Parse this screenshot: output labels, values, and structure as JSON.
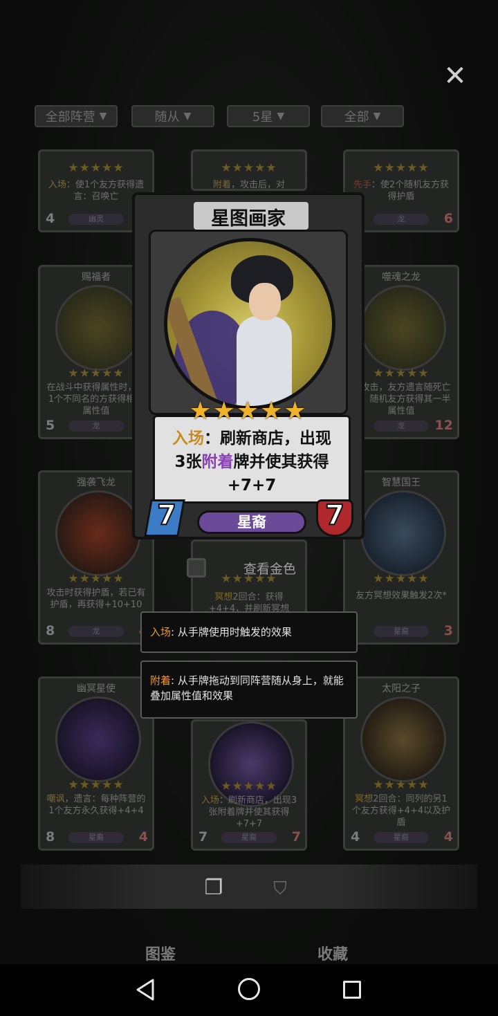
{
  "filters": [
    {
      "label": "全部阵营"
    },
    {
      "label": "随从"
    },
    {
      "label": "5星"
    },
    {
      "label": "全部"
    }
  ],
  "background_cards": [
    {
      "name": "",
      "stars": "★★★★★",
      "desc_pre": "入场",
      "desc": "：使1个友方获得遗言：召唤亡",
      "tribe": "幽灵",
      "atk": "4",
      "hp": ""
    },
    {
      "name": "",
      "stars": "★★★★★",
      "desc_pre": "附着",
      "desc": "，攻击后，对",
      "tribe": "",
      "atk": "",
      "hp": ""
    },
    {
      "name": "",
      "stars": "★★★★★",
      "desc_pre": "先手",
      "desc": "：使2个随机友方获得护盾",
      "tribe": "龙",
      "atk": "",
      "hp": "6"
    },
    {
      "name": "赐福者",
      "stars": "★★★★★",
      "desc_pre": "",
      "desc": "在战斗中获得属性时，使1个不同名的方获得相同属性值",
      "tribe": "龙",
      "atk": "5",
      "hp": ""
    },
    {
      "name": "噬魂之龙",
      "stars": "★★★★★",
      "desc_pre": "",
      "desc": "去攻击，友方遗言随死亡亡，随机友方获得其一半属性值",
      "tribe": "龙",
      "atk": "",
      "hp": "12"
    },
    {
      "name": "强袭飞龙",
      "stars": "★★★★★",
      "desc_pre": "",
      "desc": "攻击时获得护盾，若已有护盾，再获得+10+10",
      "tribe": "龙",
      "atk": "8",
      "hp": "4"
    },
    {
      "name": "",
      "stars": "★★★★★",
      "desc_pre": "冥想",
      "desc": "2回合：获得+4+4，并刷新冥想",
      "tribe": "",
      "atk": "",
      "hp": ""
    },
    {
      "name": "智慧国王",
      "stars": "★★★★★",
      "desc_pre": "",
      "desc": "友方冥想效果触发2次*",
      "tribe": "星裔",
      "atk": "",
      "hp": "3"
    },
    {
      "name": "幽冥星使",
      "stars": "★★★★★",
      "desc_pre": "嘲讽",
      "desc": "，遗言：每种阵营的1个友方永久获得+4+4",
      "tribe": "星裔",
      "atk": "8",
      "hp": "4"
    },
    {
      "name": "",
      "stars": "★★★★★",
      "desc_pre": "入场",
      "desc": "：刷新商店，出现3张附着牌并使其获得+7+7",
      "tribe": "星裔",
      "atk": "7",
      "hp": "7"
    },
    {
      "name": "太阳之子",
      "stars": "★★★★★",
      "desc_pre": "冥想",
      "desc": "2回合：同列的另1个友方获得+4+4以及护盾",
      "tribe": "星裔",
      "atk": "4",
      "hp": "4"
    }
  ],
  "featured_card": {
    "title": "星图画家",
    "stars": "★★★★★",
    "desc_kw1": "入场",
    "desc_part1": "：刷新商店，出现",
    "desc_part2_pre": "3张",
    "desc_kw2": "附着",
    "desc_part2_post": "牌并使其获得",
    "desc_part3": "+7+7",
    "atk": "7",
    "hp": "7",
    "tribe": "星裔"
  },
  "golden_toggle": {
    "label": "查看金色"
  },
  "tooltips": [
    {
      "keyword": "入场",
      "text": ": 从手牌使用时触发的效果"
    },
    {
      "keyword": "附着",
      "text": ": 从手牌拖动到同阵营随从身上，就能叠加属性值和效果"
    }
  ],
  "bottom_tabs": {
    "codex": "图鉴",
    "collection": "收藏"
  },
  "icons": {
    "close": "close-icon",
    "cards": "cards-icon",
    "book": "book-icon"
  },
  "colors": {
    "star": "#f0b22a",
    "keyword": "#e59a2e",
    "attach": "#8a3fb5",
    "hp_badge": "#b0282b",
    "atk_badge": "#3b7cc4",
    "tribe_pill": "#6a4a99"
  }
}
